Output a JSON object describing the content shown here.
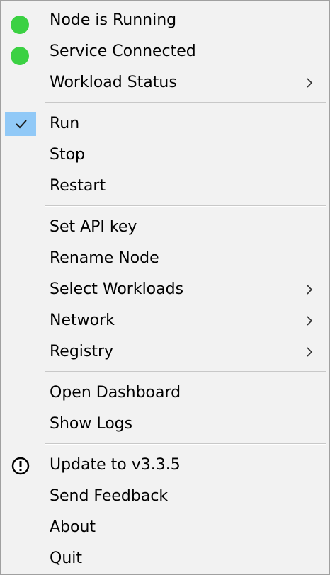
{
  "menu": {
    "status": {
      "node_running": "Node is Running",
      "service_connected": "Service Connected",
      "workload_status": "Workload Status",
      "status_color": "#3bd143"
    },
    "control": {
      "run": "Run",
      "run_checked": true,
      "stop": "Stop",
      "restart": "Restart"
    },
    "settings": {
      "set_api_key": "Set API key",
      "rename_node": "Rename Node",
      "select_workloads": "Select Workloads",
      "network": "Network",
      "registry": "Registry"
    },
    "views": {
      "open_dashboard": "Open Dashboard",
      "show_logs": "Show Logs"
    },
    "app": {
      "update": "Update to v3.3.5",
      "send_feedback": "Send Feedback",
      "about": "About",
      "quit": "Quit"
    }
  }
}
